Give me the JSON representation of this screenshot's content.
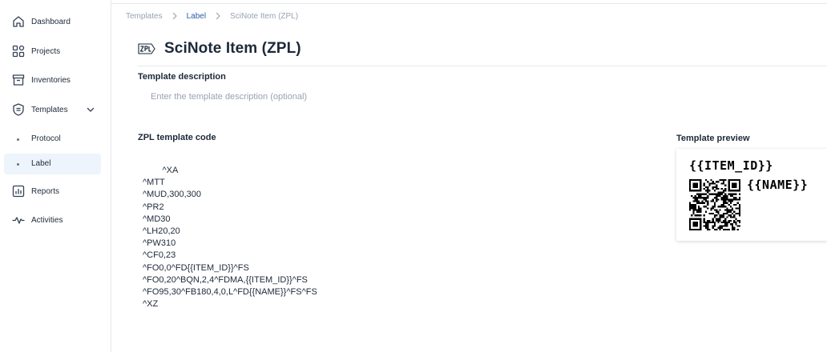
{
  "sidebar": {
    "items": [
      {
        "label": "Dashboard",
        "icon": "home-icon"
      },
      {
        "label": "Projects",
        "icon": "grid-icon"
      },
      {
        "label": "Inventories",
        "icon": "archive-icon"
      },
      {
        "label": "Templates",
        "icon": "shield-icon",
        "expanded": true
      },
      {
        "label": "Reports",
        "icon": "chart-icon"
      },
      {
        "label": "Activities",
        "icon": "pulse-icon"
      }
    ],
    "subitems": [
      {
        "label": "Protocol",
        "active": false
      },
      {
        "label": "Label",
        "active": true
      }
    ]
  },
  "breadcrumb": [
    "Templates",
    "Label",
    "SciNote Item (ZPL)"
  ],
  "page": {
    "title": "SciNote Item (ZPL)"
  },
  "description": {
    "label": "Template description",
    "placeholder": "Enter the template description (optional)",
    "value": ""
  },
  "code": {
    "label": "ZPL template code",
    "lines": [
      "        ^XA",
      "^MTT",
      "^MUD,300,300",
      "^PR2",
      "^MD30",
      "^LH20,20",
      "^PW310",
      "^CF0,23",
      "^FO0,0^FD{{ITEM_ID}}^FS",
      "^FO0,20^BQN,2,4^FDMA,{{ITEM_ID}}^FS",
      "^FO95,30^FB180,4,0,L^FD{{NAME}}^FS^FS",
      "^XZ"
    ]
  },
  "preview": {
    "label": "Template preview",
    "item_id_text": "{{ITEM_ID}}",
    "name_text": "{{NAME}}"
  },
  "colors": {
    "accent": "#2b5ea7",
    "active_bg": "#eef4fc",
    "muted": "#98a2b3"
  }
}
